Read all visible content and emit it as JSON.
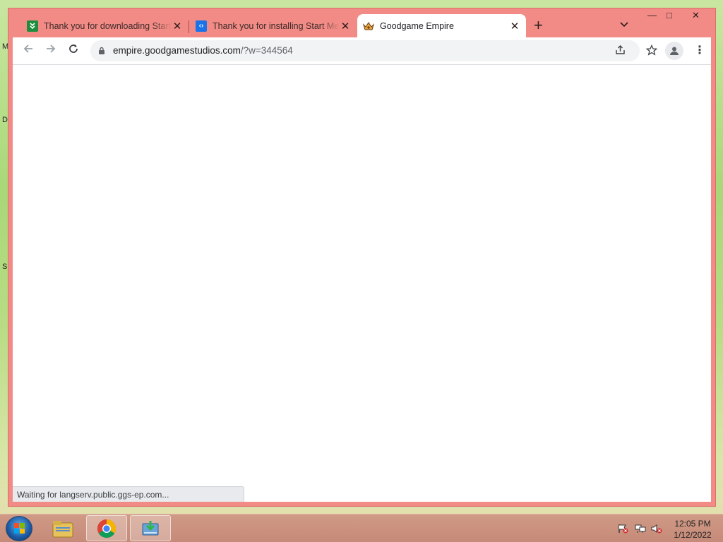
{
  "desktop": {
    "glyphs": [
      "M",
      "D",
      "S"
    ]
  },
  "browser": {
    "tabs": [
      {
        "title": "Thank you for downloading Start",
        "favicon": "green-download-icon",
        "active": false
      },
      {
        "title": "Thank you for installing Start Me",
        "favicon": "blue-code-icon",
        "active": false
      },
      {
        "title": "Goodgame Empire",
        "favicon": "crown-icon",
        "active": true
      }
    ],
    "new_tab": "+",
    "window_controls": {
      "minimize": "—",
      "maximize": "□",
      "close": "✕"
    },
    "toolbar": {
      "url_host": "empire.goodgamestudios.com",
      "url_path": "/?w=344564"
    },
    "status_text": "Waiting for langserv.public.ggs-ep.com..."
  },
  "taskbar": {
    "items": [
      "start-orb",
      "file-explorer",
      "chrome",
      "installer"
    ],
    "clock_time": "12:05 PM",
    "clock_date": "1/12/2022"
  },
  "colors": {
    "window_frame": "#f28b85",
    "taskbar": "#c68a78",
    "tab_active": "#ffffff"
  }
}
